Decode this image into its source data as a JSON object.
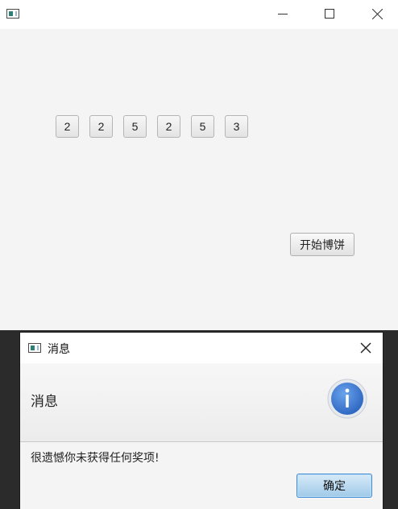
{
  "main_window": {
    "title": "",
    "dice": [
      "2",
      "2",
      "5",
      "2",
      "5",
      "3"
    ],
    "start_button_label": "开始博饼"
  },
  "dialog": {
    "title": "消息",
    "header_text": "消息",
    "content_text": "很遗憾你未获得任何奖项!",
    "ok_button_label": "确定",
    "icon": "info-icon"
  },
  "colors": {
    "window_background": "#f4f4f4",
    "titlebar_background": "#ffffff",
    "accent_blue": "#3a78d0",
    "ok_button_border": "#3e8ad4"
  },
  "icons": {
    "app": "app-icon",
    "minimize": "minimize-icon",
    "maximize": "maximize-icon",
    "close": "close-icon",
    "info": "info-icon"
  }
}
